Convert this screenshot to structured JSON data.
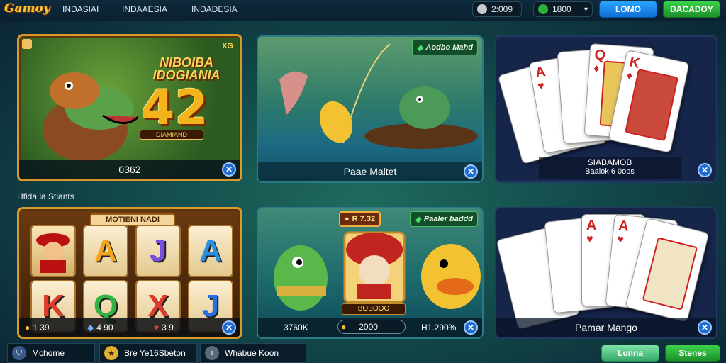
{
  "header": {
    "logo": "Gamoy",
    "nav": [
      "INDASIAI",
      "INDAAESIA",
      "INDADESIA"
    ],
    "balance_a": "2:009",
    "balance_b": "1800",
    "btn_login": "LOMO",
    "btn_register": "DACADOY"
  },
  "section_label": "Hfida la Stiants",
  "cards_top": {
    "slot_title": "NIBOIBA\nIDOGIANIA",
    "slot_big_number": "42",
    "slot_subtitle": "DIAMIAND",
    "slot_corner": "XG",
    "slot_footer": "0362",
    "fishing_tag": "Aodbo Mahd",
    "fishing_footer": "Paae Maltet",
    "cards_footer_title": "SIABAMOB",
    "cards_footer_sub": "Baalok 6 0ops"
  },
  "cards_bottom": {
    "slot_banner": "MOTIENI NADI",
    "slot_reels": [
      [
        "",
        "A",
        "J",
        "A"
      ],
      [
        "K",
        "Q",
        "X",
        "J"
      ]
    ],
    "slot_stats": [
      "1 39",
      "4 90",
      "3 9"
    ],
    "fish_tag_left": "R 7.32",
    "fish_tag_right": "Paaler baddd",
    "fish_center_label": "BOBOOO",
    "fish_stats": [
      "3760K",
      "2000",
      "H1.290%"
    ],
    "poker_footer": "Pamar Mango"
  },
  "footer": {
    "items": [
      "Mchome",
      "Bre Ye16Sbeton",
      "Whabue Koon"
    ],
    "btn_a": "Lonna",
    "btn_b": "Stenes"
  },
  "colors": {
    "gold": "#d89a2a",
    "accent_blue": "#1e6bd0",
    "accent_green": "#2cb13a"
  }
}
